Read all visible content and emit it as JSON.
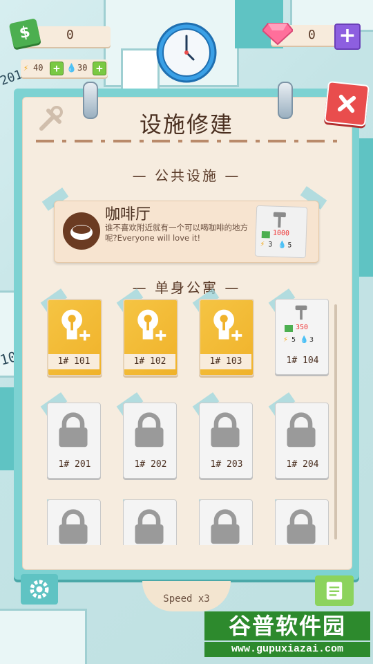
{
  "hud": {
    "coins": "0",
    "energy": "40",
    "water": "30",
    "gems": "0",
    "money_symbol": "$"
  },
  "panel": {
    "title": "设施修建",
    "sections": {
      "public": "— 公共设施 —",
      "single": "— 单身公寓 —"
    },
    "cafe": {
      "name": "咖啡厅",
      "description": "谁不喜欢附近就有一个可以喝咖啡的地方呢?Everyone will love it!",
      "cost_money": "1000",
      "cost_energy": "3",
      "cost_water": "5"
    },
    "rooms": [
      {
        "label": "1# 101",
        "state": "key"
      },
      {
        "label": "1# 102",
        "state": "key"
      },
      {
        "label": "1# 103",
        "state": "key"
      },
      {
        "label": "1# 104",
        "state": "build",
        "cost_money": "350",
        "cost_energy": "5",
        "cost_water": "3"
      },
      {
        "label": "1# 201",
        "state": "lock"
      },
      {
        "label": "1# 202",
        "state": "lock"
      },
      {
        "label": "1# 203",
        "state": "lock"
      },
      {
        "label": "1# 204",
        "state": "lock"
      },
      {
        "label": "",
        "state": "lock"
      },
      {
        "label": "",
        "state": "lock"
      },
      {
        "label": "",
        "state": "lock"
      },
      {
        "label": "",
        "state": "lock"
      }
    ]
  },
  "bottom": {
    "speed": "Speed x3"
  },
  "side": {
    "left_top": "201",
    "left_mid": "10"
  },
  "watermark": {
    "top": "谷普软件园",
    "bottom": "www.gupuxiazai.com"
  },
  "colors": {
    "panel_teal": "#7dd2d2",
    "paper": "#f6ecdf",
    "key_gold": "#f5c443",
    "close_red": "#e94d4d",
    "money_green": "#4caf50",
    "gem_purple": "#8d5fe0"
  }
}
